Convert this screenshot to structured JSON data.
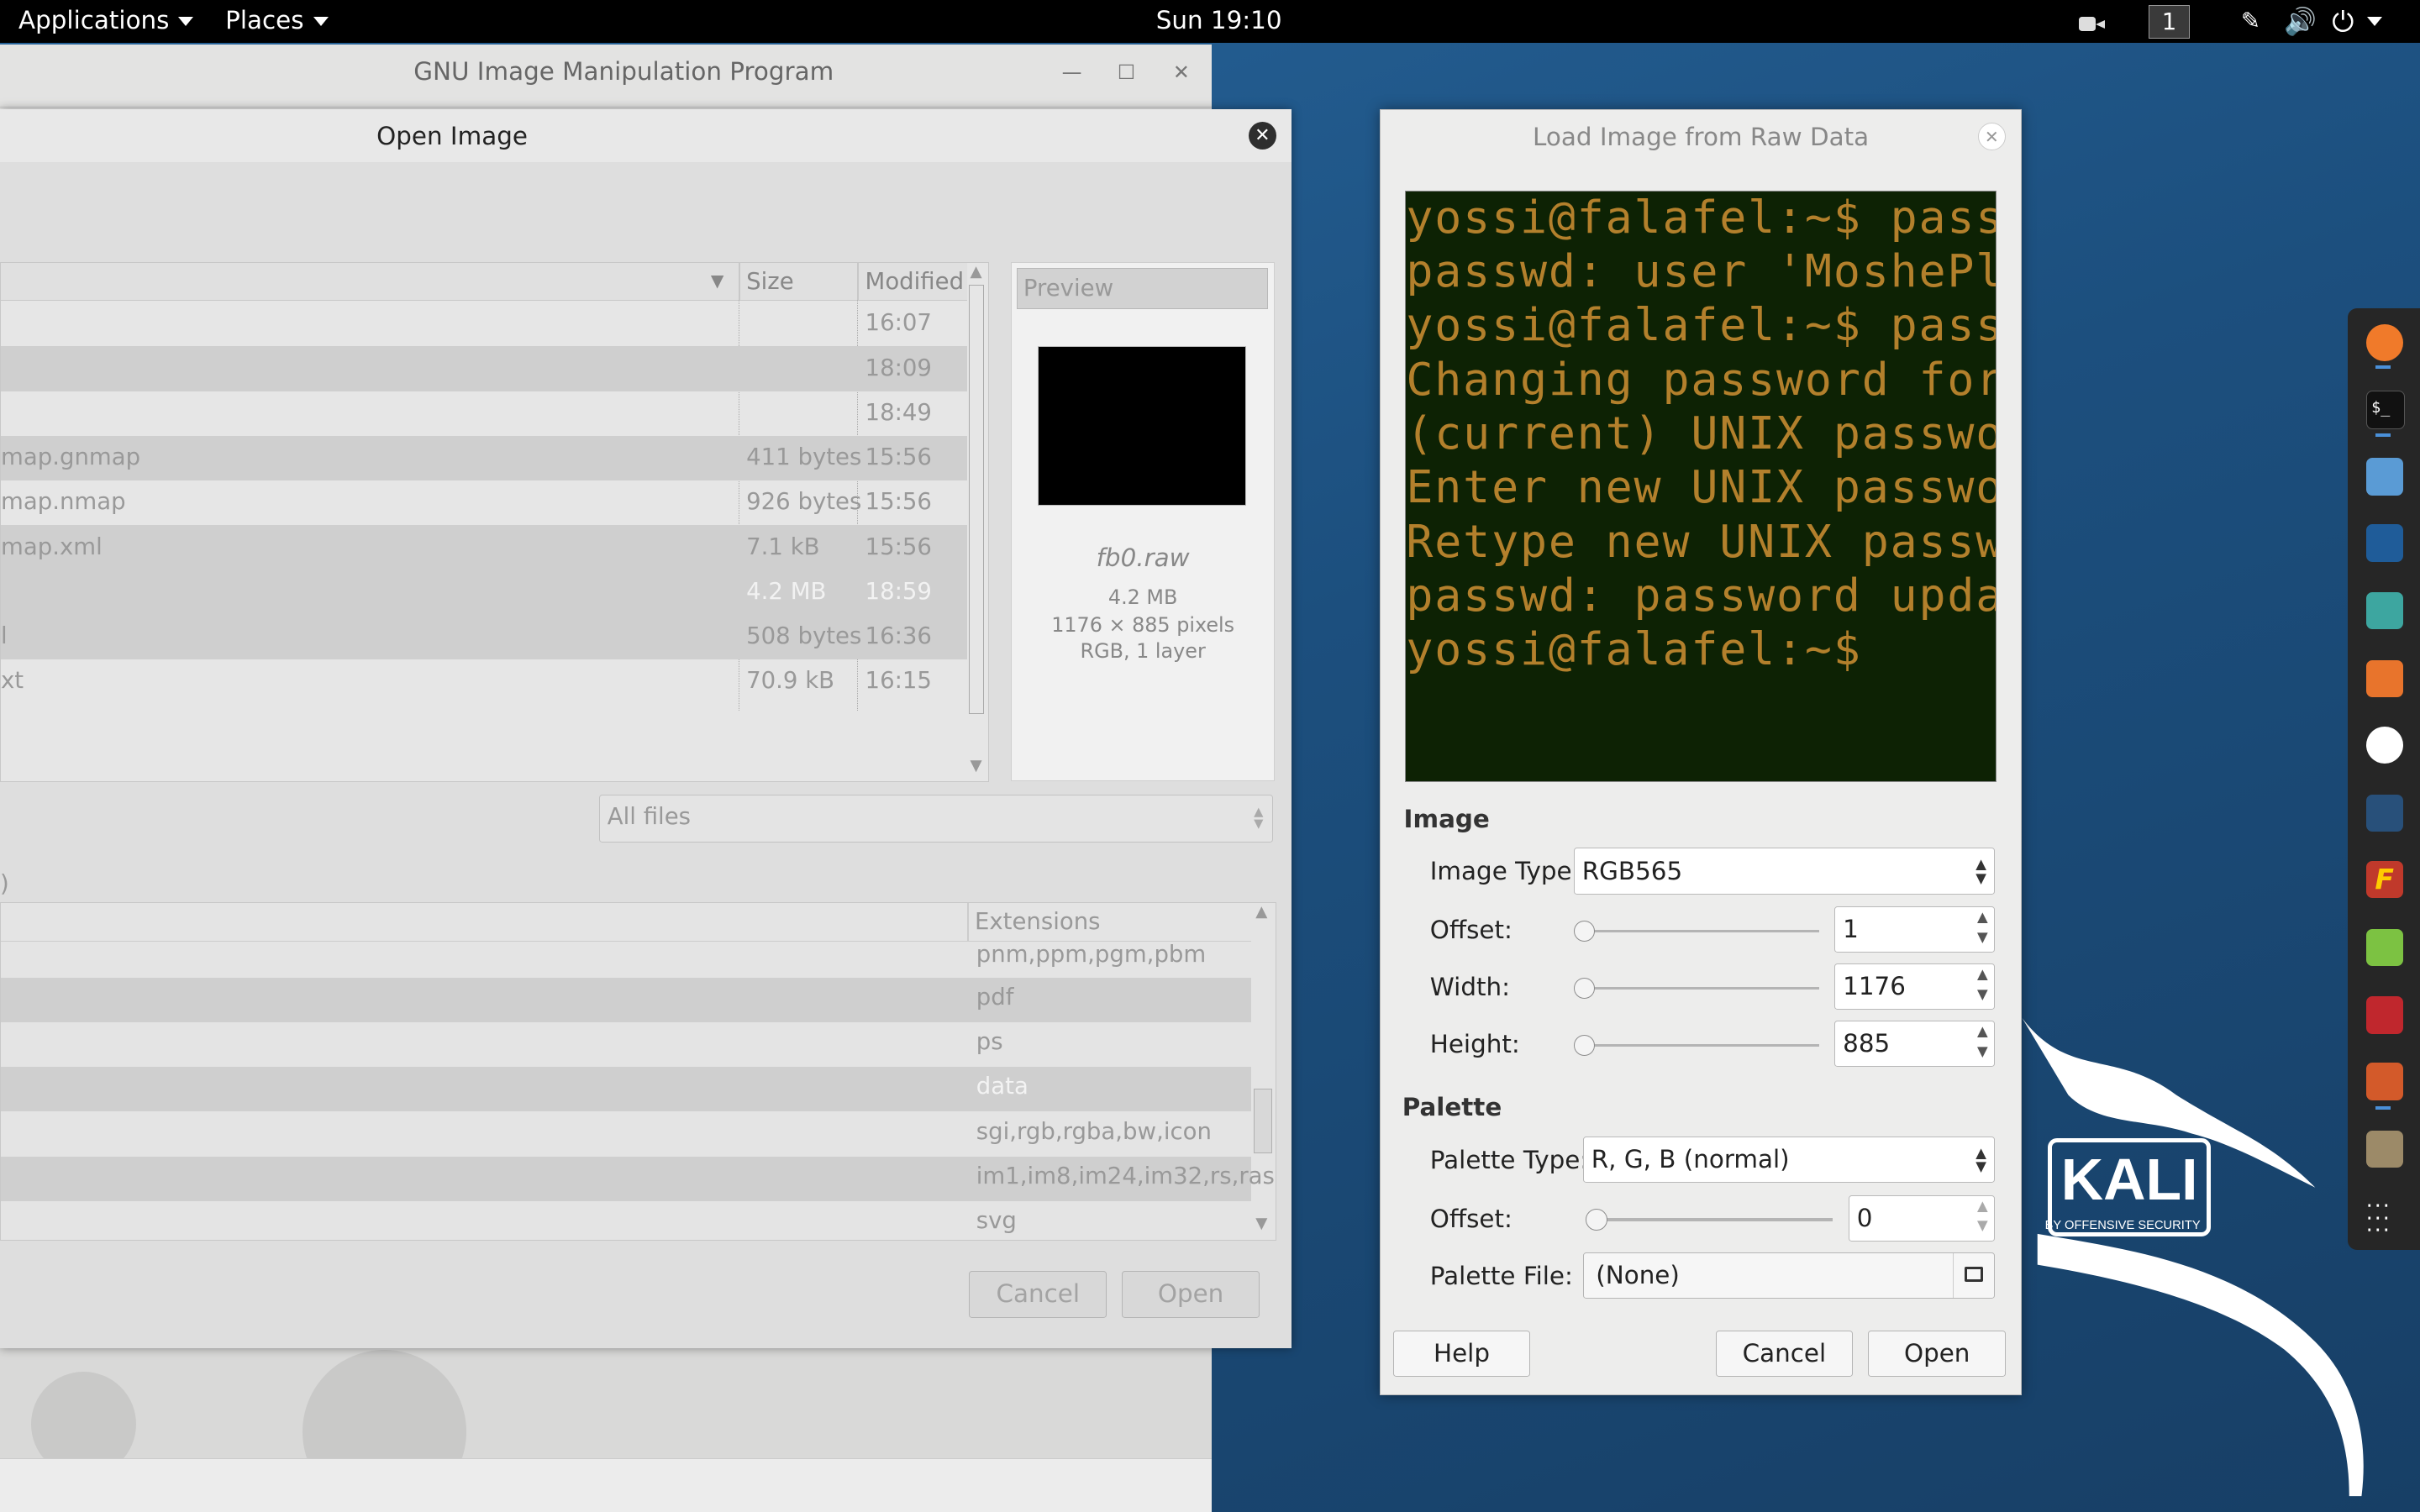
{
  "topbar": {
    "applications": "Applications",
    "places": "Places",
    "clock": "Sun 19:10",
    "workspace": "1"
  },
  "gimp_window": {
    "title": "GNU Image Manipulation Program"
  },
  "open_dialog": {
    "title": "Open Image",
    "columns": {
      "size": "Size",
      "modified": "Modified"
    },
    "files": [
      {
        "name": "",
        "size": "",
        "modified": "16:07"
      },
      {
        "name": "",
        "size": "",
        "modified": "18:09"
      },
      {
        "name": "",
        "size": "",
        "modified": "18:49"
      },
      {
        "name": "map.gnmap",
        "size": "411 bytes",
        "modified": "15:56"
      },
      {
        "name": "map.nmap",
        "size": "926 bytes",
        "modified": "15:56"
      },
      {
        "name": "map.xml",
        "size": "7.1 kB",
        "modified": "15:56"
      },
      {
        "name": "",
        "size": "4.2 MB",
        "modified": "18:59"
      },
      {
        "name": "l",
        "size": "508 bytes",
        "modified": "16:36"
      },
      {
        "name": "xt",
        "size": "70.9 kB",
        "modified": "16:15"
      }
    ],
    "preview": {
      "header": "Preview",
      "filename": "fb0.raw",
      "size": "4.2 MB",
      "dimensions": "1176 × 885 pixels",
      "mode": "RGB, 1 layer"
    },
    "filter": "All files",
    "type_label_fragment": ")",
    "extensions_header": "Extensions",
    "extensions": [
      "pnm,ppm,pgm,pbm",
      "pdf",
      "ps",
      "data",
      "sgi,rgb,rgba,bw,icon",
      "im1,im8,im24,im32,rs,ras",
      "svg"
    ],
    "cancel": "Cancel",
    "open": "Open"
  },
  "raw_dialog": {
    "title": "Load Image from Raw Data",
    "terminal_lines": [
      "yossi@falafel:~$ passw",
      "passwd: user 'MoshePlz",
      "yossi@falafel:~$ passw",
      "Changing password for",
      "(current) UNIX passwor",
      "Enter new UNIX passwor",
      "Retype new UNIX passwo",
      "passwd: password updat",
      "yossi@falafel:~$"
    ],
    "image_section": "Image",
    "image_type_label": "Image Type:",
    "image_type_value": "RGB565",
    "offset_label": "Offset:",
    "offset_value": "1",
    "width_label": "Width:",
    "width_value": "1176",
    "height_label": "Height:",
    "height_value": "885",
    "palette_section": "Palette",
    "palette_type_label": "Palette Type:",
    "palette_type_value": "R, G, B (normal)",
    "palette_offset_label": "Offset:",
    "palette_offset_value": "0",
    "palette_file_label": "Palette File:",
    "palette_file_value": "(None)",
    "help": "Help",
    "cancel": "Cancel",
    "open": "Open"
  },
  "dock_icons": [
    "firefox-icon",
    "terminal-icon",
    "files-icon",
    "metasploit-icon",
    "armitage-icon",
    "burpsuite-icon",
    "beef-icon",
    "kismet-icon",
    "faraday-icon",
    "leafpad-icon",
    "terminal-red-icon",
    "reports-icon",
    "gimp-icon",
    "app-grid-icon"
  ],
  "kali": {
    "logo": "KALI",
    "tagline": "BY OFFENSIVE SECURITY"
  },
  "colors": {
    "terminal_bg": "#0d2204",
    "terminal_text": "#b3802c",
    "desktop": "#1d4a73"
  }
}
